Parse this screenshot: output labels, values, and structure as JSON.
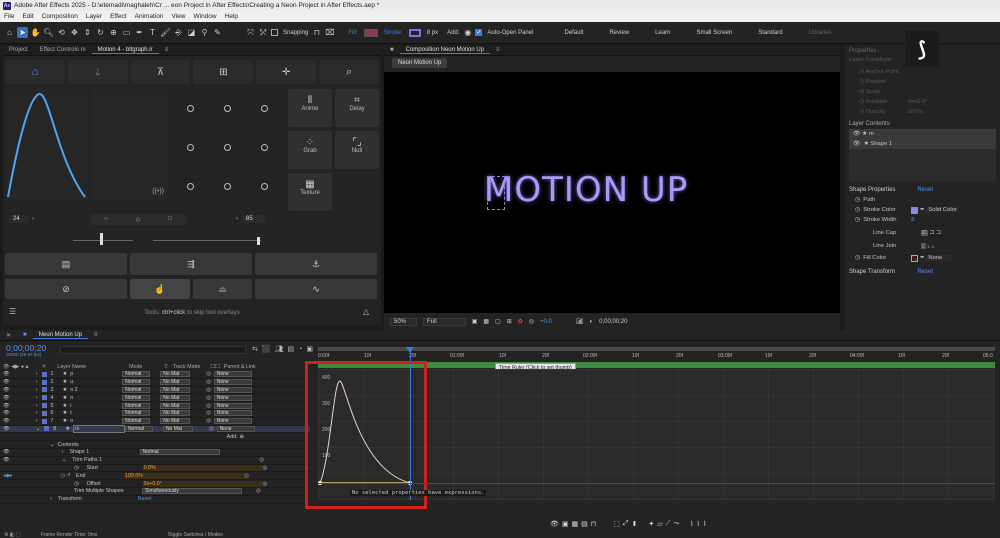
{
  "app": {
    "title": "Adobe After Effects 2025 - D:\\etemadi\\maghaleh\\Cr ... eon Project in After Effects\\Creating a Neon Project in After Effects.aep *",
    "logo": "Ae"
  },
  "menu": [
    "File",
    "Edit",
    "Composition",
    "Layer",
    "Effect",
    "Animation",
    "View",
    "Window",
    "Help"
  ],
  "toolbar": {
    "snapping": "Snapping",
    "fill_label": "Fill:",
    "stroke_label": "Stroke:",
    "stroke_px": "8 px",
    "add_label": "Add:",
    "auto_open": "Auto-Open Panel",
    "fill_color": "#8a3a4a",
    "stroke_color": "#7b74e8",
    "workspaces": [
      "Default",
      "Review",
      "Learn",
      "Small Screen",
      "Standard",
      "Libraries"
    ]
  },
  "left_panel": {
    "tabs": [
      "Project",
      "Effect Controls m",
      "Motion 4 - bltgraph.ir"
    ],
    "active_tab": 2,
    "left_value": "24",
    "right_value": "85",
    "buttons": [
      {
        "label": "Anime",
        "icon": "anime-icon"
      },
      {
        "label": "Delay",
        "icon": "delay-icon"
      },
      {
        "label": "Grab",
        "icon": "grab-icon"
      },
      {
        "label": "Null",
        "icon": "null-icon"
      },
      {
        "label": "Texture",
        "icon": "texture-icon"
      }
    ],
    "tools_hint_prefix": "Tools: ",
    "tools_hint_key": "ctrl+click",
    "tools_hint_suffix": " to skip tool overlays"
  },
  "composition": {
    "tab": "Composition Neon Motion Up",
    "sub_tab": "Neon Motion Up",
    "text": "MOTION UP",
    "text_color": "#a99cf0",
    "zoom": "50%",
    "quality": "Full",
    "exposure": "+0.0",
    "timecode": "0;00;00;20"
  },
  "properties": {
    "title": "Properties",
    "layer_transform": "Layer Transform",
    "transform_items": [
      "Anchor Point",
      "Position",
      "Scale",
      "Rotation",
      "Opacity"
    ],
    "transform_values": [
      "",
      "",
      "",
      "0x+0.0°",
      "100%"
    ],
    "layer_contents": "Layer Contents",
    "content_items": [
      "m",
      "Shape 1"
    ],
    "shape_properties": "Shape Properties",
    "reset": "Reset",
    "rows": [
      {
        "label": "Path",
        "value": ""
      },
      {
        "label": "Stroke Color",
        "value": "Solid Color"
      },
      {
        "label": "Stroke Width",
        "value": "8"
      },
      {
        "label": "Line Cap",
        "value": ""
      },
      {
        "label": "Line Join",
        "value": ""
      },
      {
        "label": "Fill Color",
        "value": "None"
      }
    ],
    "shape_transform": "Shape Transform"
  },
  "timeline": {
    "comp_name": "Neon Motion Up",
    "timecode": "0;00;00;20",
    "timecode_sub": "00020 (29.97 fps)",
    "search_placeholder": "",
    "headers": {
      "num": "#",
      "layer_name": "Layer Name",
      "mode": "Mode",
      "t": "T",
      "track_matte": "Track Matte",
      "parent": "Parent & Link"
    },
    "layers": [
      {
        "num": "1",
        "name": "p",
        "mode": "Normal",
        "matte": "No Mat",
        "parent": "None"
      },
      {
        "num": "2",
        "name": "u",
        "mode": "Normal",
        "matte": "No Mat",
        "parent": "None"
      },
      {
        "num": "3",
        "name": "o 2",
        "mode": "Normal",
        "matte": "No Mat",
        "parent": "None"
      },
      {
        "num": "4",
        "name": "n",
        "mode": "Normal",
        "matte": "No Mat",
        "parent": "None"
      },
      {
        "num": "5",
        "name": "i",
        "mode": "Normal",
        "matte": "No Mat",
        "parent": "None"
      },
      {
        "num": "6",
        "name": "t",
        "mode": "Normal",
        "matte": "No Mat",
        "parent": "None"
      },
      {
        "num": "7",
        "name": "o",
        "mode": "Normal",
        "matte": "No Mat",
        "parent": "None"
      },
      {
        "num": "8",
        "name": "m",
        "mode": "Normal",
        "matte": "No Mat",
        "parent": "None"
      }
    ],
    "add_label": "Add:",
    "contents_label": "Contents",
    "shape_label": "Shape 1",
    "shape_mode": "Normal",
    "trim_label": "Trim Paths 1",
    "trim_rows": [
      {
        "label": "Start",
        "value": "0.0%"
      },
      {
        "label": "End",
        "value": "100.0%"
      },
      {
        "label": "Offset",
        "value": "0x+0.0°"
      }
    ],
    "trim_multiple": "Trim Multiple Shapes",
    "trim_multiple_value": "Simultaneously",
    "transform_label": "Transform",
    "transform_value": "Reset",
    "ruler_ticks": [
      "0:00f",
      "10f",
      "20f",
      "01:00f",
      "10f",
      "20f",
      "02:00f",
      "10f",
      "20f",
      "03:00f",
      "10f",
      "20f",
      "04:00f",
      "10f",
      "20f",
      "05:0"
    ],
    "tooltip": "Time Ruler (Click to set thumb)",
    "graph_labels": [
      "400",
      "300",
      "200",
      "100"
    ],
    "graph_message": "No selected properties have expressions.",
    "footer_left": "Frame Render Time: 0ms",
    "footer_mid": "Toggle Switches / Modes"
  }
}
